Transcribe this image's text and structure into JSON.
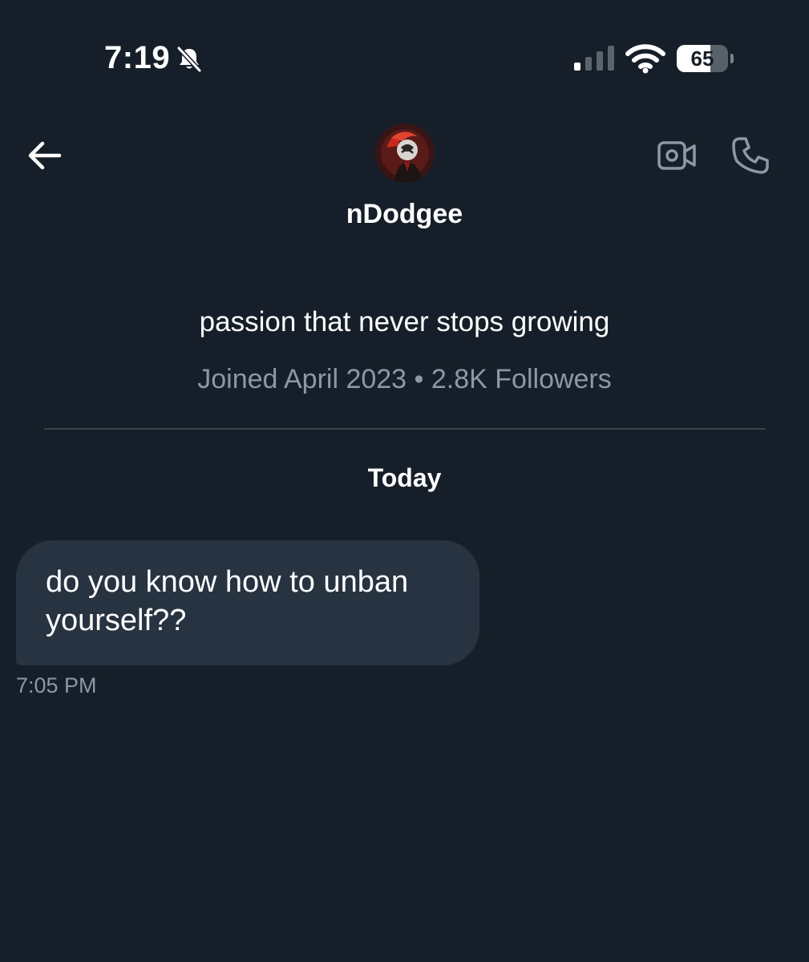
{
  "status_bar": {
    "time": "7:19",
    "battery_level": "65",
    "battery_fraction": 0.65,
    "icons": [
      "bell-muted-icon",
      "signal-icon",
      "wifi-icon",
      "battery-icon"
    ]
  },
  "header": {
    "back_icon": "arrow-left-icon",
    "name": "nDodgee",
    "video_icon": "video-camera-icon",
    "phone_icon": "phone-icon"
  },
  "profile": {
    "bio": "passion that never stops growing",
    "meta": "Joined April 2023 • 2.8K Followers"
  },
  "conversation": {
    "date_label": "Today",
    "messages": [
      {
        "text": "do you know how to unban yourself??",
        "time": "7:05 PM"
      }
    ]
  },
  "colors": {
    "background": "#161f29",
    "bubble": "#273340",
    "secondary_text": "#8b98a5",
    "divider": "#38444d"
  }
}
